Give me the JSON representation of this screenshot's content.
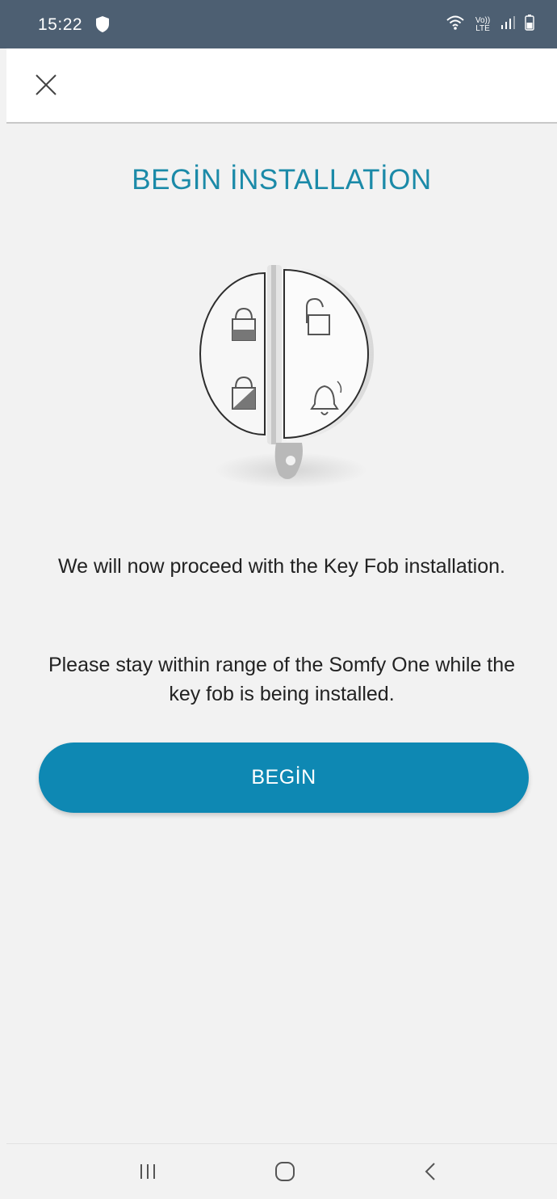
{
  "status_bar": {
    "time": "15:22",
    "volte_top": "Vo))",
    "volte_bottom": "LTE",
    "icons": [
      "shield-icon",
      "wifi-icon",
      "volte-icon",
      "signal-icon",
      "battery-icon"
    ]
  },
  "header": {
    "close_icon": "close-icon"
  },
  "main": {
    "title": "BEGİN İNSTALLATİON",
    "image": "key-fob-illustration",
    "message_1": "We will now proceed with the Key Fob installation.",
    "message_2": "Please stay within range of the Somfy One while the key fob is being installed.",
    "begin_label": "BEGİN"
  },
  "nav_bar": {
    "buttons": [
      "recents-icon",
      "home-icon",
      "back-icon"
    ]
  },
  "colors": {
    "status_bar_bg": "#4d5f72",
    "accent": "#1b8aa8",
    "button_bg": "#0e88b3",
    "background": "#f2f2f2"
  }
}
